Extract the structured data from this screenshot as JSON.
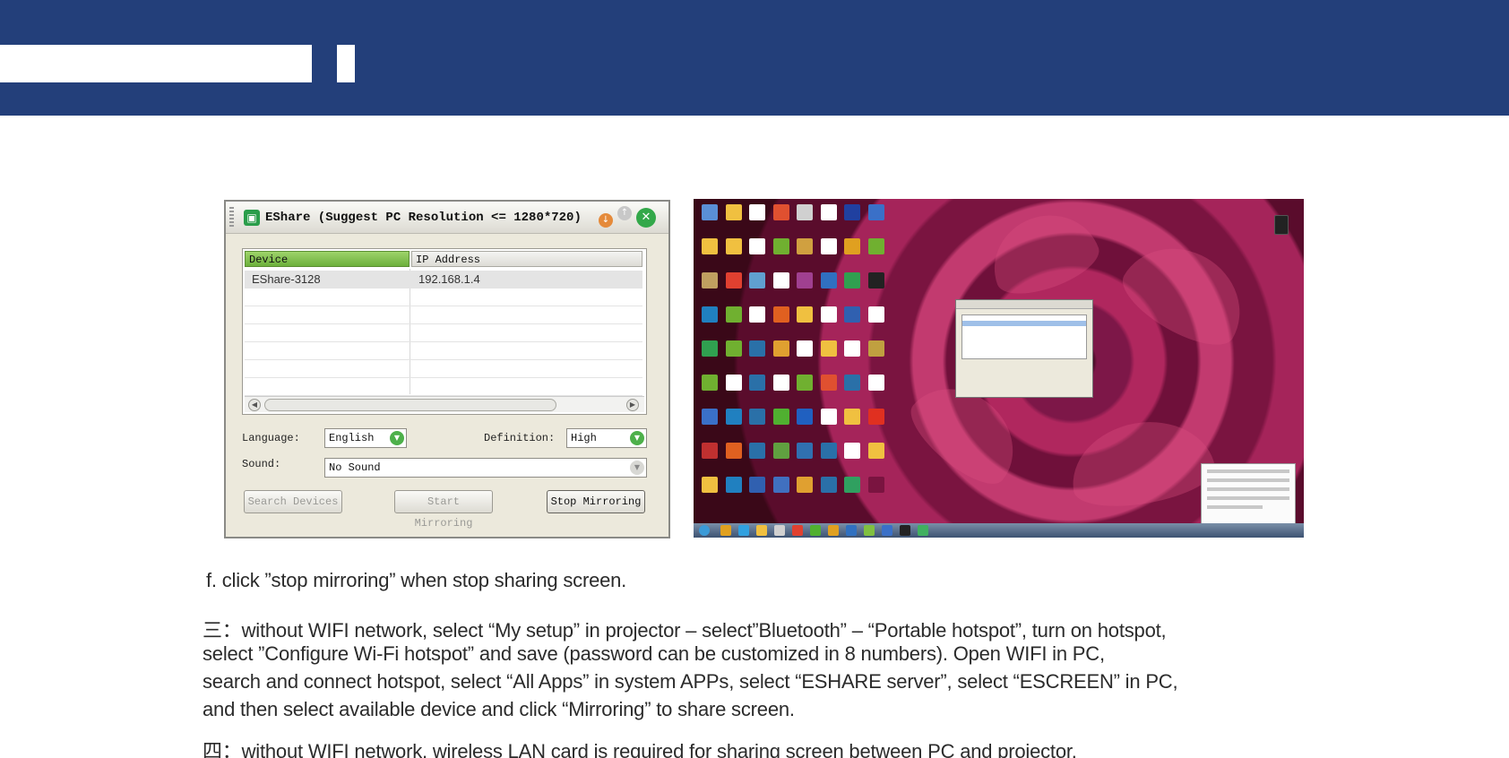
{
  "app_window": {
    "title": "EShare (Suggest PC Resolution <= 1280*720)",
    "icon": "eshare-app-icon",
    "columns": [
      "Device",
      "IP Address"
    ],
    "rows": [
      {
        "device": "EShare-3128",
        "ip": "192.168.1.4"
      }
    ],
    "language_label": "Language:",
    "language_value": "English",
    "definition_label": "Definition:",
    "definition_value": "High",
    "sound_label": "Sound:",
    "sound_value": "No Sound",
    "search_button": "Search Devices",
    "start_button": "Start Mirroring",
    "stop_button": "Stop Mirroring"
  },
  "desktop_screenshot": {
    "description_icon": "windows-desktop-flower-wallpaper"
  },
  "instructions": {
    "step_f": "f. click ”stop mirroring” when stop sharing screen.",
    "section3_line1": "三：without WIFI network, select “My setup” in projector – select”Bluetooth” – “Portable hotspot”, turn on hotspot,",
    "section3_line2": "select ”Configure Wi-Fi hotspot” and save (password can be customized in 8 numbers). Open WIFI in PC,",
    "section3_line3": "search and connect hotspot, select “All Apps” in system APPs, select “ESHARE server”, select “ESCREEN” in PC,",
    "section3_line4": "and then select available device and click “Mirroring” to share screen.",
    "section4_line1": "四：without WIFI network, wireless LAN card is required for sharing screen between PC and projector."
  },
  "colors": {
    "header": "#233f7a",
    "accent_green": "#6cb03c"
  }
}
